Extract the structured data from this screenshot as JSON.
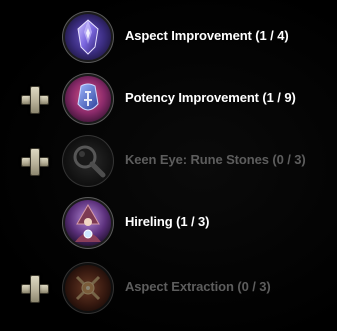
{
  "skills": [
    {
      "name": "Aspect Improvement (1 / 4)",
      "icon": "aspect-gem-icon",
      "active": true,
      "has_plus": false
    },
    {
      "name": "Potency Improvement (1 / 9)",
      "icon": "potency-rune-icon",
      "active": true,
      "has_plus": true
    },
    {
      "name": "Keen Eye: Rune Stones (0 / 3)",
      "icon": "magnifying-glass-icon",
      "active": false,
      "has_plus": true
    },
    {
      "name": "Hireling (1 / 3)",
      "icon": "hireling-mage-icon",
      "active": true,
      "has_plus": false
    },
    {
      "name": "Aspect Extraction (0 / 3)",
      "icon": "aspect-extraction-icon",
      "active": false,
      "has_plus": true
    }
  ],
  "colors": {
    "active_text": "#ffffff",
    "inactive_text": "#5d5d5d",
    "plus_button": "#c8c1a8",
    "background": "#000000"
  }
}
